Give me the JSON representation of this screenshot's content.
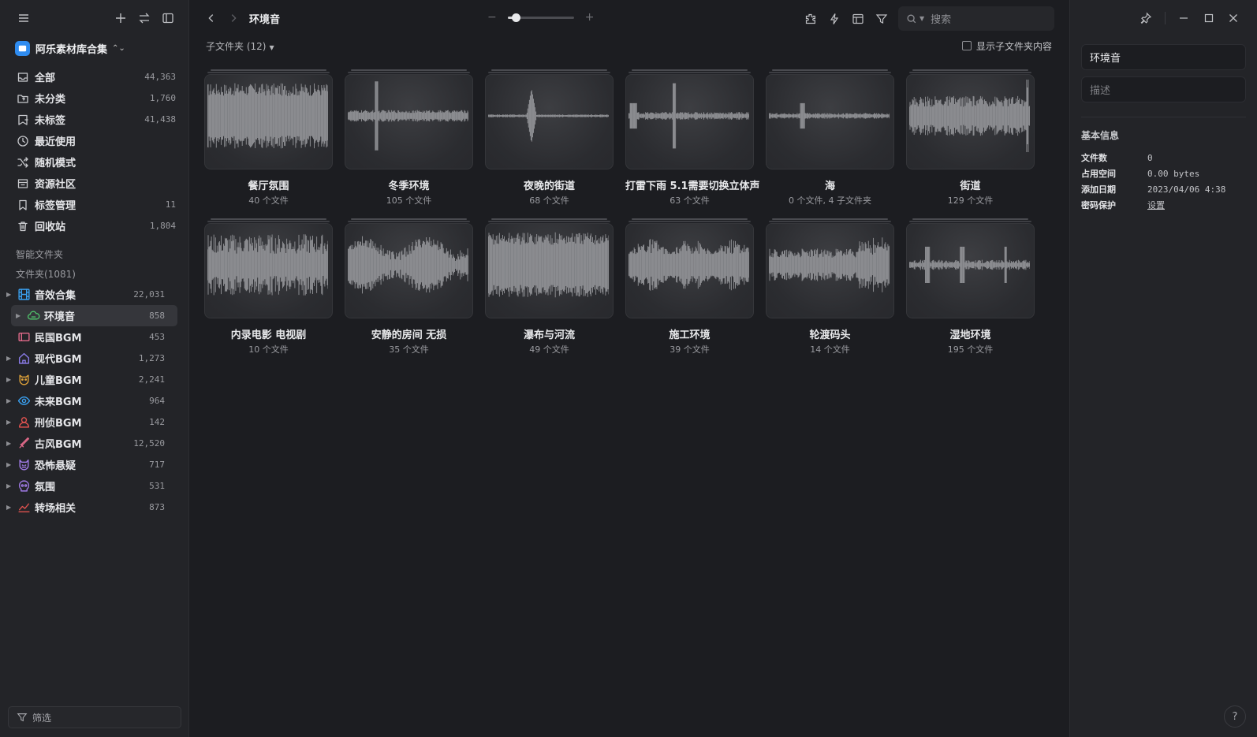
{
  "sidebar": {
    "library_name": "阿乐素材库合集",
    "nav": [
      {
        "label": "全部",
        "count": "44,363",
        "icon": "inbox-icon"
      },
      {
        "label": "未分类",
        "count": "1,760",
        "icon": "folder-question-icon"
      },
      {
        "label": "未标签",
        "count": "41,438",
        "icon": "tag-off-icon"
      },
      {
        "label": "最近使用",
        "count": "",
        "icon": "clock-icon"
      },
      {
        "label": "随机模式",
        "count": "",
        "icon": "shuffle-icon"
      },
      {
        "label": "资源社区",
        "count": "",
        "icon": "store-icon"
      },
      {
        "label": "标签管理",
        "count": "11",
        "icon": "bookmark-icon"
      },
      {
        "label": "回收站",
        "count": "1,804",
        "icon": "trash-icon"
      }
    ],
    "smart_folders_label": "智能文件夹",
    "folders_label": "文件夹(1081)",
    "folders": [
      {
        "label": "音效合集",
        "count": "22,031",
        "color": "#3aa0f0",
        "icon": "film-icon",
        "expandable": true
      },
      {
        "label": "环境音",
        "count": "858",
        "color": "#4fc06a",
        "icon": "cloud-icon",
        "expandable": true,
        "active": true
      },
      {
        "label": "民国BGM",
        "count": "453",
        "color": "#e26a8a",
        "icon": "tv-icon",
        "expandable": false
      },
      {
        "label": "现代BGM",
        "count": "1,273",
        "color": "#8a7be8",
        "icon": "home-icon",
        "expandable": true
      },
      {
        "label": "儿童BGM",
        "count": "2,241",
        "color": "#e0a33a",
        "icon": "cat-icon",
        "expandable": true
      },
      {
        "label": "未来BGM",
        "count": "964",
        "color": "#3aa0f0",
        "icon": "eye-icon",
        "expandable": true
      },
      {
        "label": "刑侦BGM",
        "count": "142",
        "color": "#e0524f",
        "icon": "user-icon",
        "expandable": true
      },
      {
        "label": "古风BGM",
        "count": "12,520",
        "color": "#e26a8a",
        "icon": "sword-icon",
        "expandable": true
      },
      {
        "label": "恐怖悬疑",
        "count": "717",
        "color": "#a27be8",
        "icon": "devil-icon",
        "expandable": true
      },
      {
        "label": "氛围",
        "count": "531",
        "color": "#a27be8",
        "icon": "skull-icon",
        "expandable": true
      },
      {
        "label": "转场相关",
        "count": "873",
        "color": "#e0524f",
        "icon": "chart-icon",
        "expandable": true
      }
    ],
    "filter_label": "筛选"
  },
  "toolbar": {
    "crumb": "环境音",
    "zoom_level": 0.12,
    "search_placeholder": "搜索"
  },
  "subbar": {
    "subfolders_label": "子文件夹 (12)",
    "show_sub_label": "显示子文件夹内容"
  },
  "cards": [
    {
      "name": "餐厅氛围",
      "meta": "40 个文件",
      "wave": "dense"
    },
    {
      "name": "冬季环境",
      "meta": "105 个文件",
      "wave": "spike"
    },
    {
      "name": "夜晚的街道",
      "meta": "68 个文件",
      "wave": "center"
    },
    {
      "name": "打雷下雨 5.1需要切换立体声",
      "meta": "63 个文件",
      "wave": "thunder"
    },
    {
      "name": "海",
      "meta": "0 个文件, 4 子文件夹",
      "wave": "sea"
    },
    {
      "name": "街道",
      "meta": "129 个文件",
      "wave": "street"
    },
    {
      "name": "内录电影 电视剧",
      "meta": "10 个文件",
      "wave": "film"
    },
    {
      "name": "安静的房间 无损",
      "meta": "35 个文件",
      "wave": "room"
    },
    {
      "name": "瀑布与河流",
      "meta": "49 个文件",
      "wave": "dense"
    },
    {
      "name": "施工环境",
      "meta": "39 个文件",
      "wave": "construct"
    },
    {
      "name": "轮渡码头",
      "meta": "14 个文件",
      "wave": "ferry"
    },
    {
      "name": "湿地环境",
      "meta": "195 个文件",
      "wave": "wetland"
    }
  ],
  "inspector": {
    "title": "环境音",
    "desc_placeholder": "描述",
    "section": "基本信息",
    "rows": [
      {
        "k": "文件数",
        "v": "0"
      },
      {
        "k": "占用空间",
        "v": "0.00 bytes"
      },
      {
        "k": "添加日期",
        "v": "2023/04/06 4:38"
      },
      {
        "k": "密码保护",
        "v": "设置"
      }
    ]
  }
}
